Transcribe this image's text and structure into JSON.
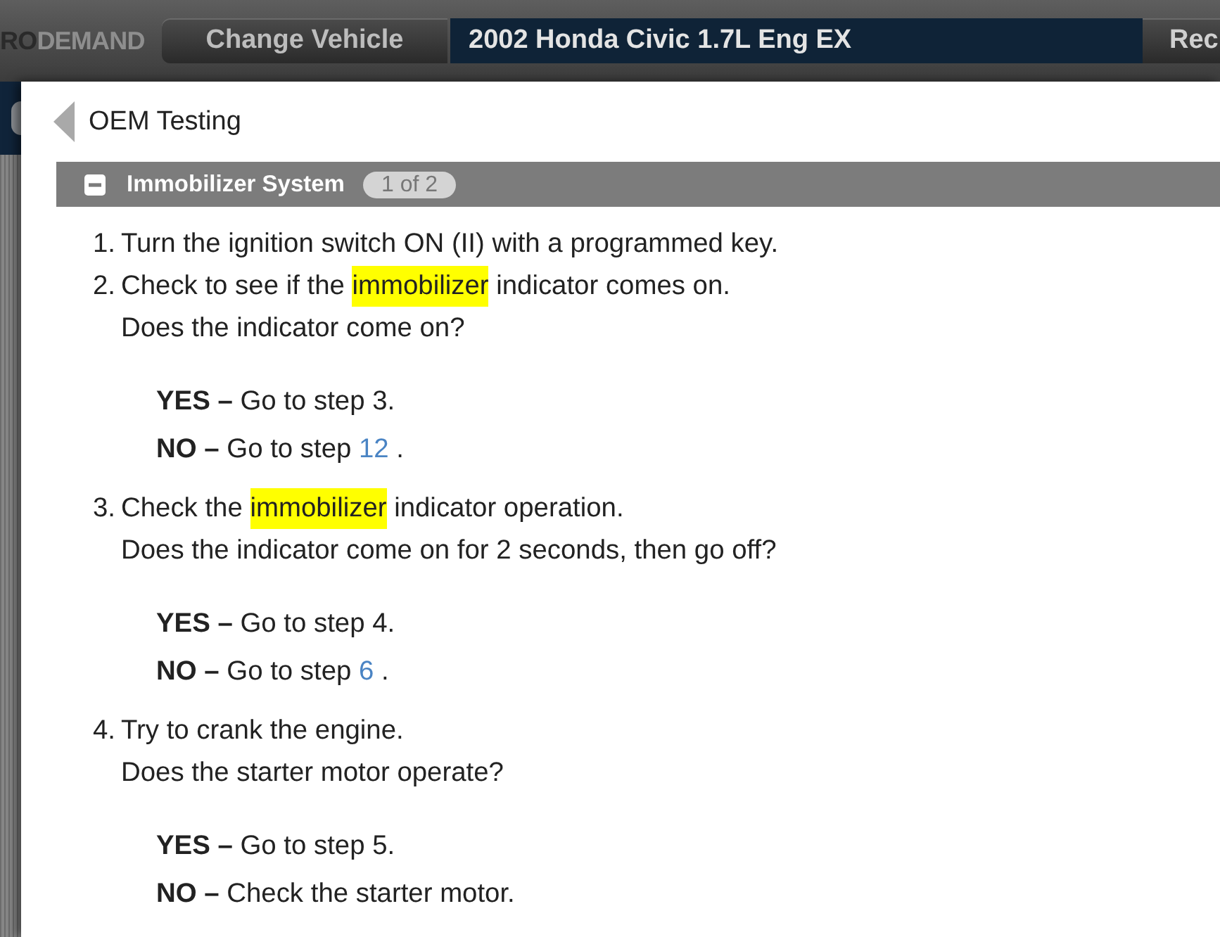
{
  "top_bar": {
    "logo": [
      {
        "text": "RO",
        "dimmed": false
      },
      {
        "text": "DEMAND",
        "dimmed": true
      }
    ],
    "change_vehicle_button": "Change Vehicle",
    "vehicle_name": "2002 Honda Civic 1.7L Eng EX",
    "button_3": "Rec"
  },
  "panel": {
    "title": "OEM Testing",
    "section": {
      "title": "Immobilizer System",
      "expanded": true,
      "counter": "1 of 2",
      "steps": [
        {
          "number": "1.",
          "text": [
            {
              "kind": "text",
              "text": "Turn the ignition switch ON (II) with a programmed key."
            }
          ]
        },
        {
          "number": "2.",
          "text": [
            {
              "kind": "text",
              "text": "Check to see if the "
            },
            {
              "kind": "highlight",
              "text": "immobilizer"
            },
            {
              "kind": "text",
              "text": " indicator comes on."
            }
          ],
          "question": "Does the indicator come on?",
          "answers": [
            {
              "label": "YES –",
              "text": [
                {
                  "kind": "text",
                  "text": "Go to step 3."
                }
              ]
            },
            {
              "label": "NO –",
              "text": [
                {
                  "kind": "text",
                  "text": "Go to step "
                },
                {
                  "kind": "link",
                  "text": "12"
                },
                {
                  "kind": "text",
                  "text": " ."
                }
              ]
            }
          ]
        },
        {
          "number": "3.",
          "text": [
            {
              "kind": "text",
              "text": "Check the "
            },
            {
              "kind": "highlight",
              "text": "immobilizer"
            },
            {
              "kind": "text",
              "text": " indicator operation."
            }
          ],
          "question": "Does the indicator come on for 2 seconds, then go off?",
          "answers": [
            {
              "label": "YES –",
              "text": [
                {
                  "kind": "text",
                  "text": "Go to step 4."
                }
              ]
            },
            {
              "label": "NO –",
              "text": [
                {
                  "kind": "text",
                  "text": "Go to step "
                },
                {
                  "kind": "link",
                  "text": "6"
                },
                {
                  "kind": "text",
                  "text": " ."
                }
              ]
            }
          ]
        },
        {
          "number": "4.",
          "text": [
            {
              "kind": "text",
              "text": "Try to crank the engine."
            }
          ],
          "question": "Does the starter motor operate?",
          "answers": [
            {
              "label": "YES –",
              "text": [
                {
                  "kind": "text",
                  "text": "Go to step 5."
                }
              ]
            },
            {
              "label": "NO –",
              "text": [
                {
                  "kind": "text",
                  "text": "Check the starter motor."
                }
              ]
            }
          ]
        }
      ]
    }
  }
}
